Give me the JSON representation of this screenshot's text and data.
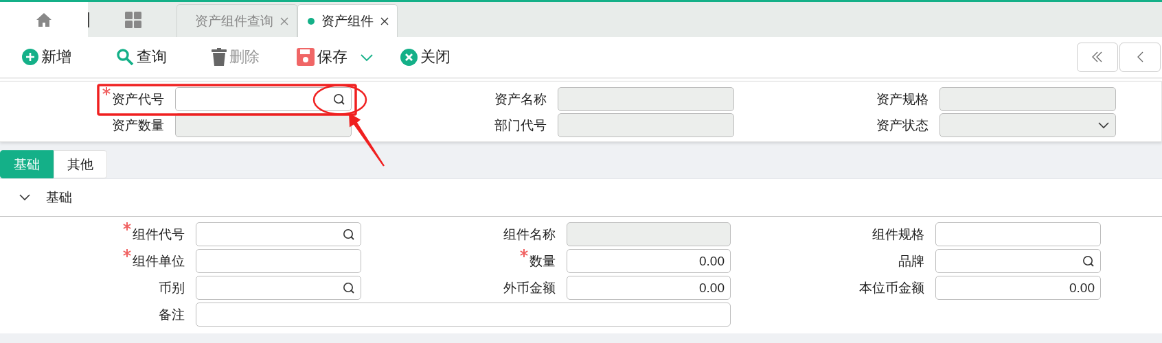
{
  "tab_bar": {
    "tabs": [
      {
        "label": "资产组件查询",
        "selected": false
      },
      {
        "label": "资产组件",
        "selected": true
      }
    ]
  },
  "toolbar": {
    "buttons": [
      {
        "label": "新增",
        "kind": "add",
        "disabled": false
      },
      {
        "label": "查询",
        "kind": "search",
        "disabled": false
      },
      {
        "label": "删除",
        "kind": "delete",
        "disabled": true
      },
      {
        "label": "保存",
        "kind": "save",
        "disabled": false
      },
      {
        "label": "关闭",
        "kind": "close",
        "disabled": false
      }
    ]
  },
  "header_form": {
    "fields": [
      {
        "label": "资产代号",
        "required": true,
        "kind": "search",
        "highlighted": true
      },
      {
        "label": "资产名称",
        "required": false,
        "kind": "readonly",
        "highlighted": false
      },
      {
        "label": "资产规格",
        "required": false,
        "kind": "readonly",
        "highlighted": false
      },
      {
        "label": "资产数量",
        "required": false,
        "kind": "readonly",
        "highlighted": false
      },
      {
        "label": "部门代号",
        "required": false,
        "kind": "readonly",
        "highlighted": false
      },
      {
        "label": "资产状态",
        "required": false,
        "kind": "select",
        "highlighted": false
      }
    ]
  },
  "section_tabs": [
    {
      "label": "基础",
      "selected": true
    },
    {
      "label": "其他",
      "selected": false
    }
  ],
  "section": {
    "title": "基础",
    "expanded": true,
    "fields": [
      {
        "label": "组件代号",
        "required": true,
        "kind": "search"
      },
      {
        "label": "组件名称",
        "required": false,
        "kind": "readonly"
      },
      {
        "label": "组件规格",
        "required": false,
        "kind": "text"
      },
      {
        "label": "组件单位",
        "required": true,
        "kind": "text"
      },
      {
        "label": "数量",
        "required": true,
        "kind": "number",
        "value": "0.00"
      },
      {
        "label": "品牌",
        "required": false,
        "kind": "search"
      },
      {
        "label": "币别",
        "required": false,
        "kind": "search"
      },
      {
        "label": "外币金额",
        "required": false,
        "kind": "number",
        "value": "0.00"
      },
      {
        "label": "本位币金额",
        "required": false,
        "kind": "number",
        "value": "0.00"
      },
      {
        "label": "备注",
        "required": false,
        "kind": "wide"
      }
    ]
  }
}
